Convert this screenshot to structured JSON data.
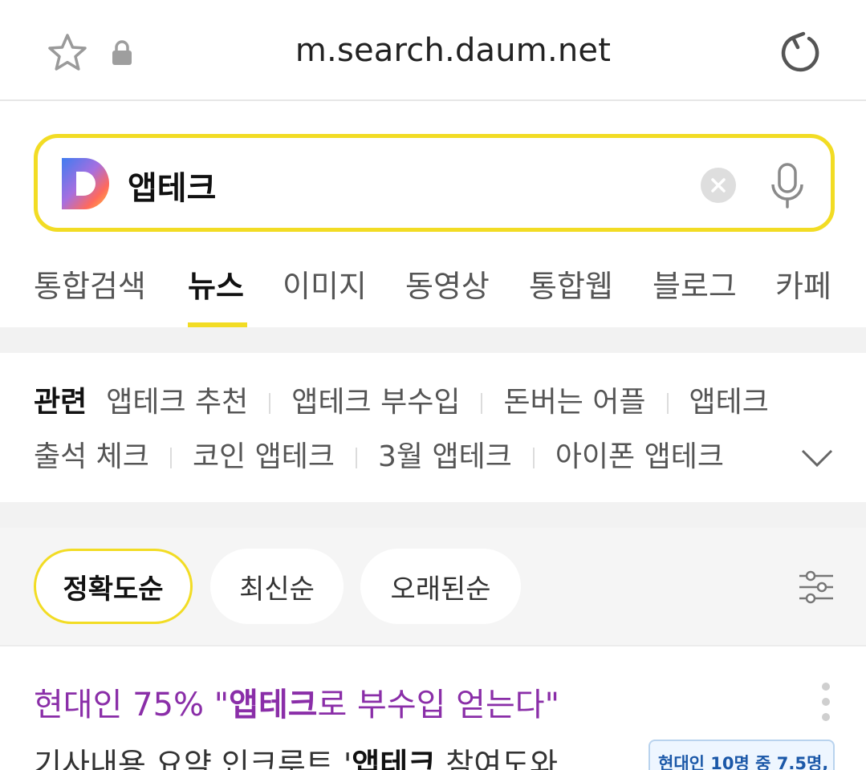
{
  "browser": {
    "url": "m.search.daum.net"
  },
  "search": {
    "query": "앱테크",
    "logo_letter": "D"
  },
  "tabs": [
    {
      "label": "통합검색",
      "active": false
    },
    {
      "label": "뉴스",
      "active": true
    },
    {
      "label": "이미지",
      "active": false
    },
    {
      "label": "동영상",
      "active": false
    },
    {
      "label": "통합웹",
      "active": false
    },
    {
      "label": "블로그",
      "active": false
    },
    {
      "label": "카페",
      "active": false
    }
  ],
  "related": {
    "heading": "관련",
    "items": [
      "앱테크 추천",
      "앱테크 부수입",
      "돈버는 어플",
      "앱테크",
      "출석 체크",
      "코인 앱테크",
      "3월 앱테크",
      "아이폰 앱테크"
    ]
  },
  "sort": {
    "options": [
      "정확도순",
      "최신순",
      "오래된순"
    ],
    "selected": "정확도순"
  },
  "article": {
    "title_pre": "현대인 75% \"",
    "title_highlight": "앱테크",
    "title_post": "로 부수입 얻는다\"",
    "snippet_pre": "기사내용 요약 인크루트 '",
    "snippet_highlight": "앱테크",
    "snippet_post": " 참여도와",
    "thumbnail_text": "현대인 10명 중 7.5명,"
  },
  "colors": {
    "accent_yellow": "#f2dc24",
    "title_purple": "#8a2ea8",
    "section_gray": "#f2f2f2"
  }
}
